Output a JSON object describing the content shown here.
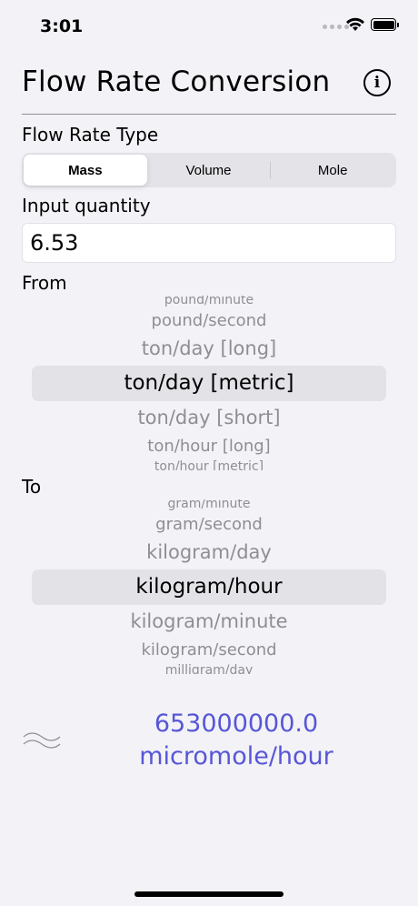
{
  "status_bar": {
    "time": "3:01"
  },
  "header": {
    "title": "Flow Rate Conversion",
    "info_icon": "info-circle-icon"
  },
  "flow_type": {
    "label": "Flow Rate Type",
    "segments": [
      "Mass",
      "Volume",
      "Mole"
    ],
    "selected": "Mass"
  },
  "input": {
    "label": "Input quantity",
    "value": "6.53"
  },
  "from": {
    "label": "From",
    "items": [
      "pound/minute",
      "pound/second",
      "ton/day [long]",
      "ton/day [metric]",
      "ton/day [short]",
      "ton/hour [long]",
      "ton/hour [metric]"
    ],
    "selected": "ton/day [metric]"
  },
  "to": {
    "label": "To",
    "items": [
      "gram/minute",
      "gram/second",
      "kilogram/day",
      "kilogram/hour",
      "kilogram/minute",
      "kilogram/second",
      "milligram/day"
    ],
    "selected": "kilogram/hour"
  },
  "result": {
    "approx_icon": "approximately-equal-icon",
    "value": "653000000.0",
    "unit": "micromole/hour"
  },
  "colors": {
    "background": "#f2f2f7",
    "accent": "#5856d6",
    "picker_highlight": "#e2e2e7",
    "secondary_text": "#8e8e93"
  }
}
